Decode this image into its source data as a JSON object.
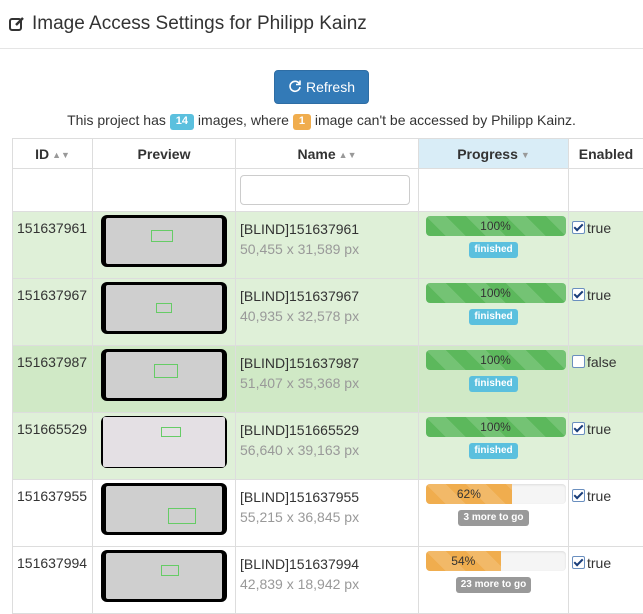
{
  "header": {
    "title": "Image Access Settings for Philipp Kainz",
    "icon": "edit-icon"
  },
  "toolbar": {
    "refresh_label": "Refresh",
    "refresh_icon": "refresh-icon"
  },
  "summary": {
    "prefix": "This project has",
    "image_count": "14",
    "middle": "images, where",
    "blocked_count": "1",
    "suffix": "image can't be accessed by Philipp Kainz."
  },
  "table": {
    "columns": {
      "id": "ID",
      "preview": "Preview",
      "name": "Name",
      "progress": "Progress",
      "enabled": "Enabled"
    },
    "name_filter": {
      "value": "",
      "placeholder": ""
    },
    "rows": [
      {
        "id": "151637961",
        "name": "[BLIND]151637961",
        "dims": "50,455 x 31,589 px",
        "progress": "100%",
        "progress_value": 100,
        "status": "finished",
        "enabled": "true",
        "checked": true
      },
      {
        "id": "151637967",
        "name": "[BLIND]151637967",
        "dims": "40,935 x 32,578 px",
        "progress": "100%",
        "progress_value": 100,
        "status": "finished",
        "enabled": "true",
        "checked": true
      },
      {
        "id": "151637987",
        "name": "[BLIND]151637987",
        "dims": "51,407 x 35,368 px",
        "progress": "100%",
        "progress_value": 100,
        "status": "finished",
        "enabled": "false",
        "checked": false
      },
      {
        "id": "151665529",
        "name": "[BLIND]151665529",
        "dims": "56,640 x 39,163 px",
        "progress": "100%",
        "progress_value": 100,
        "status": "finished",
        "enabled": "true",
        "checked": true
      },
      {
        "id": "151637955",
        "name": "[BLIND]151637955",
        "dims": "55,215 x 36,845 px",
        "progress": "62%",
        "progress_value": 62,
        "status": "3 more to go",
        "enabled": "true",
        "checked": true
      },
      {
        "id": "151637994",
        "name": "[BLIND]151637994",
        "dims": "42,839 x 18,942 px",
        "progress": "54%",
        "progress_value": 54,
        "status": "23 more to go",
        "enabled": "true",
        "checked": true
      }
    ]
  },
  "colors": {
    "primary": "#337ab7",
    "success": "#5cb85c",
    "warning": "#f0ad4e",
    "info": "#5bc0de",
    "row_green": "#dff0d8"
  }
}
